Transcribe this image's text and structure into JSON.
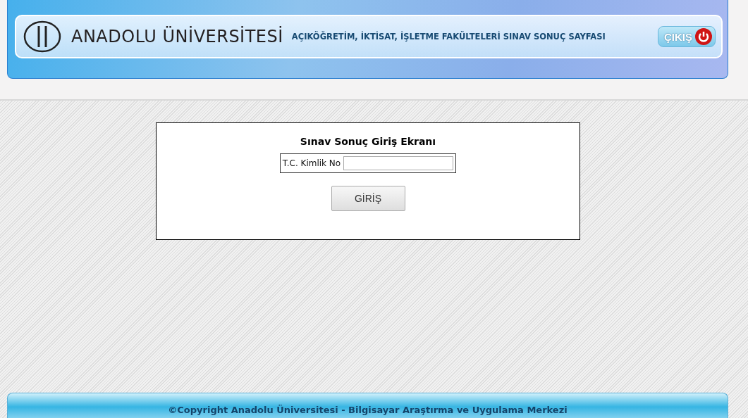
{
  "header": {
    "logo_text": "ANADOLU ÜNİVERSİTESİ",
    "page_title": "AÇIKÖĞRETİM, İKTİSAT, İŞLETME FAKÜLTELERİ SINAV SONUÇ SAYFASI",
    "logout_button": "ÇIKIŞ"
  },
  "login": {
    "title": "Sınav Sonuç Giriş Ekranı",
    "field_label": "T.C. Kimlik No",
    "submit_button": "GİRİŞ"
  },
  "footer": {
    "copyright": "©Copyright Anadolu Üniversitesi - Bilgisayar Araştırma ve Uygulama Merkezi"
  }
}
